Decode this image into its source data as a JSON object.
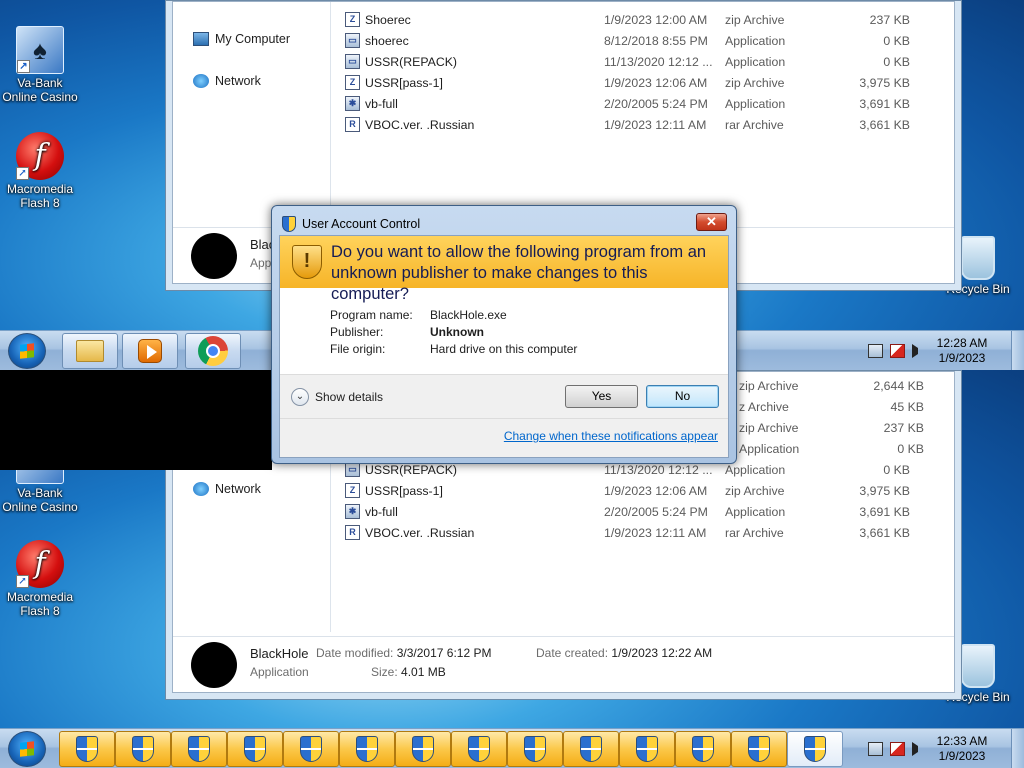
{
  "desktop": {
    "icons": [
      {
        "label_1": "Va-Bank",
        "label_2": "Online Casino",
        "glyph": "♠"
      },
      {
        "label_1": "Macromedia",
        "label_2": "Flash 8",
        "glyph": "f"
      },
      {
        "label": "Recycle Bin"
      }
    ]
  },
  "explorer": {
    "nav": {
      "computer": "My Computer",
      "network": "Network"
    },
    "files_top": [
      {
        "name": "Shoerec",
        "date": "1/9/2023 12:00 AM",
        "type": "zip Archive",
        "size": "237 KB",
        "icon": "Z"
      },
      {
        "name": "shoerec",
        "date": "8/12/2018 8:55 PM",
        "type": "Application",
        "size": "0 KB",
        "icon": "▭"
      },
      {
        "name": "USSR(REPACK)",
        "date": "11/13/2020 12:12 ...",
        "type": "Application",
        "size": "0 KB",
        "icon": "▭"
      },
      {
        "name": "USSR[pass-1]",
        "date": "1/9/2023 12:06 AM",
        "type": "zip Archive",
        "size": "3,975 KB",
        "icon": "Z"
      },
      {
        "name": "vb-full",
        "date": "2/20/2005 5:24 PM",
        "type": "Application",
        "size": "3,691 KB",
        "icon": "✱"
      },
      {
        "name": "VBOC.ver. .Russian",
        "date": "1/9/2023 12:11 AM",
        "type": "rar Archive",
        "size": "3,661 KB",
        "icon": "R"
      }
    ],
    "files_bottom_partial": [
      {
        "type": "zip Archive",
        "size": "2,644 KB"
      },
      {
        "type": "z Archive",
        "size": "45 KB"
      },
      {
        "type": "zip Archive",
        "size": "237 KB"
      },
      {
        "type": "Application",
        "size": "0 KB"
      }
    ],
    "details_top": {
      "name": "Blac",
      "type": "App"
    },
    "details": {
      "name": "BlackHole",
      "type": "Application",
      "modified_label": "Date modified:",
      "modified": "3/3/2017 6:12 PM",
      "size_label": "Size:",
      "size": "4.01 MB",
      "created_label": "Date created:",
      "created": "1/9/2023 12:22 AM"
    }
  },
  "taskbar_top": {
    "time": "12:28 AM",
    "date": "1/9/2023"
  },
  "taskbar_bottom": {
    "time": "12:33 AM",
    "date": "1/9/2023"
  },
  "uac": {
    "title": "User Account Control",
    "close": "✕",
    "question": "Do you want to allow the following program from an unknown publisher to make changes to this computer?",
    "program_name_label": "Program name:",
    "program_name": "BlackHole.exe",
    "publisher_label": "Publisher:",
    "publisher": "Unknown",
    "origin_label": "File origin:",
    "origin": "Hard drive on this computer",
    "show_details": "Show details",
    "yes": "Yes",
    "no": "No",
    "notify_link": "Change when these notifications appear"
  },
  "colors": {
    "uac_banner": "#f6b428",
    "link": "#0066cc",
    "taskbar": "#a8c4e2"
  }
}
